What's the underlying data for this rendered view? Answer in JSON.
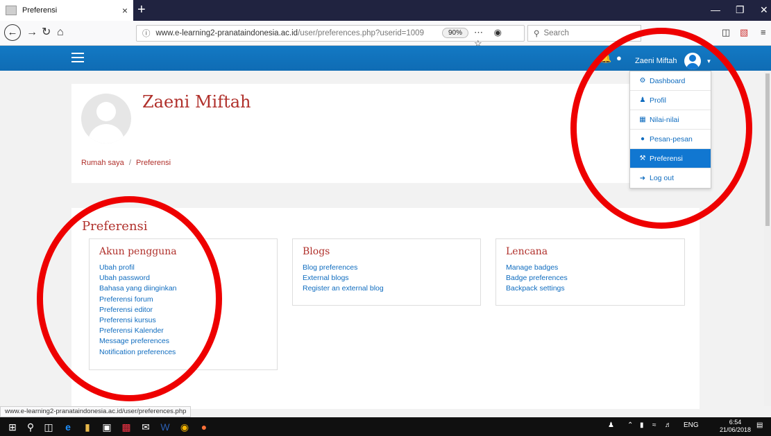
{
  "browser": {
    "tab_title": "Preferensi",
    "tab_close": "×",
    "new_tab": "+",
    "url_host": "www.e-learning2-pranataindonesia.ac.id",
    "url_path": "/user/preferences.php?userid=1009",
    "zoom": "90%",
    "search_placeholder": "Search",
    "status_url": "www.e-learning2-pranataindonesia.ac.id/user/preferences.php"
  },
  "header": {
    "user_name": "Zaeni Miftah"
  },
  "profile": {
    "name": "Zaeni Miftah",
    "breadcrumb": [
      "Rumah saya",
      "Preferensi"
    ],
    "breadcrumb_sep": "/"
  },
  "user_menu": [
    {
      "label": "Dashboard",
      "icon": "dashboard-icon",
      "active": false
    },
    {
      "label": "Profil",
      "icon": "user-icon",
      "active": false
    },
    {
      "label": "Nilai-nilai",
      "icon": "table-icon",
      "active": false
    },
    {
      "label": "Pesan-pesan",
      "icon": "chat-icon",
      "active": false
    },
    {
      "label": "Preferensi",
      "icon": "wrench-icon",
      "active": true
    },
    {
      "label": "Log out",
      "icon": "logout-icon",
      "active": false
    }
  ],
  "preferences": {
    "title": "Preferensi",
    "sections": [
      {
        "title": "Akun pengguna",
        "links": [
          "Ubah profil",
          "Ubah password",
          "Bahasa yang diinginkan",
          "Preferensi forum",
          "Preferensi editor",
          "Preferensi kursus",
          "Preferensi Kalender",
          "Message preferences",
          "Notification preferences"
        ]
      },
      {
        "title": "Blogs",
        "links": [
          "Blog preferences",
          "External blogs",
          "Register an external blog"
        ]
      },
      {
        "title": "Lencana",
        "links": [
          "Manage badges",
          "Badge preferences",
          "Backpack settings"
        ]
      }
    ]
  },
  "taskbar": {
    "time": "6:54",
    "date": "21/06/2018",
    "lang": "ENG"
  },
  "colors": {
    "moodle_blue": "#1177d1",
    "accent_red": "#b0302b",
    "link_blue": "#0f6cbf",
    "annotation_red": "#ee0000"
  }
}
